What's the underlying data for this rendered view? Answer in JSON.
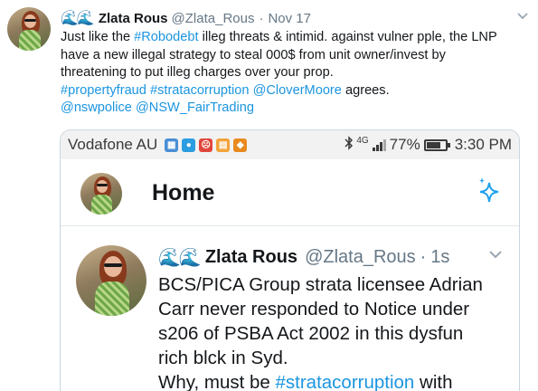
{
  "tweet": {
    "wave_emoji": "🌊🌊",
    "author_name": "Zlata Rous",
    "author_handle": "@Zlata_Rous",
    "separator": "·",
    "date": "Nov 17",
    "more_icon": "chevron-down-icon",
    "text_lines": [
      [
        {
          "t": "Just like the ",
          "link": false
        },
        {
          "t": "#Robodebt",
          "link": true
        },
        {
          "t": " illeg threats & intimid. against vulner pple, the LNP",
          "link": false
        }
      ],
      [
        {
          "t": "have a new illegal strategy to steal 000$ from unit owner/invest by",
          "link": false
        }
      ],
      [
        {
          "t": "threatening to put illeg charges over your prop.",
          "link": false
        }
      ],
      [
        {
          "t": "#propertyfraud",
          "link": true
        },
        {
          "t": " ",
          "link": false
        },
        {
          "t": "#stratacorruption",
          "link": true
        },
        {
          "t": " ",
          "link": false
        },
        {
          "t": "@CloverMoore",
          "link": true
        },
        {
          "t": " agrees.",
          "link": false
        }
      ],
      [
        {
          "t": "@nswpolice",
          "link": true
        },
        {
          "t": " ",
          "link": false
        },
        {
          "t": "@NSW_FairTrading",
          "link": true
        }
      ]
    ]
  },
  "screenshot": {
    "status_bar": {
      "carrier": "Vodafone AU",
      "network": "4G",
      "battery": "77%",
      "time": "3:30 PM",
      "notification_colors": [
        "#4a8fd6",
        "#2b9de0",
        "#e0463c",
        "#f2a33a",
        "#e88a1e"
      ]
    },
    "home": {
      "title": "Home",
      "sparkle_icon": "sparkle-icon"
    },
    "inner_tweet": {
      "wave_emoji": "🌊🌊",
      "author_name": "Zlata Rous",
      "author_handle": "@Zlata_Rous",
      "separator": "·",
      "time": "1s",
      "lines": [
        [
          {
            "t": "BCS/PICA Group strata licensee Adrian",
            "link": false
          }
        ],
        [
          {
            "t": "Carr never responded to Notice under",
            "link": false
          }
        ],
        [
          {
            "t": "s206 of PSBA Act 2002 in this dysfun",
            "link": false
          }
        ],
        [
          {
            "t": "rich blck in Syd.",
            "link": false
          }
        ],
        [
          {
            "t": "Why, must be ",
            "link": false
          },
          {
            "t": "#stratacorruption",
            "link": true
          },
          {
            "t": " with",
            "link": false
          }
        ]
      ]
    }
  },
  "colors": {
    "link": "#1b95e0",
    "muted": "#657786",
    "border": "#ccd6dd",
    "wave": "#3b88c3"
  }
}
